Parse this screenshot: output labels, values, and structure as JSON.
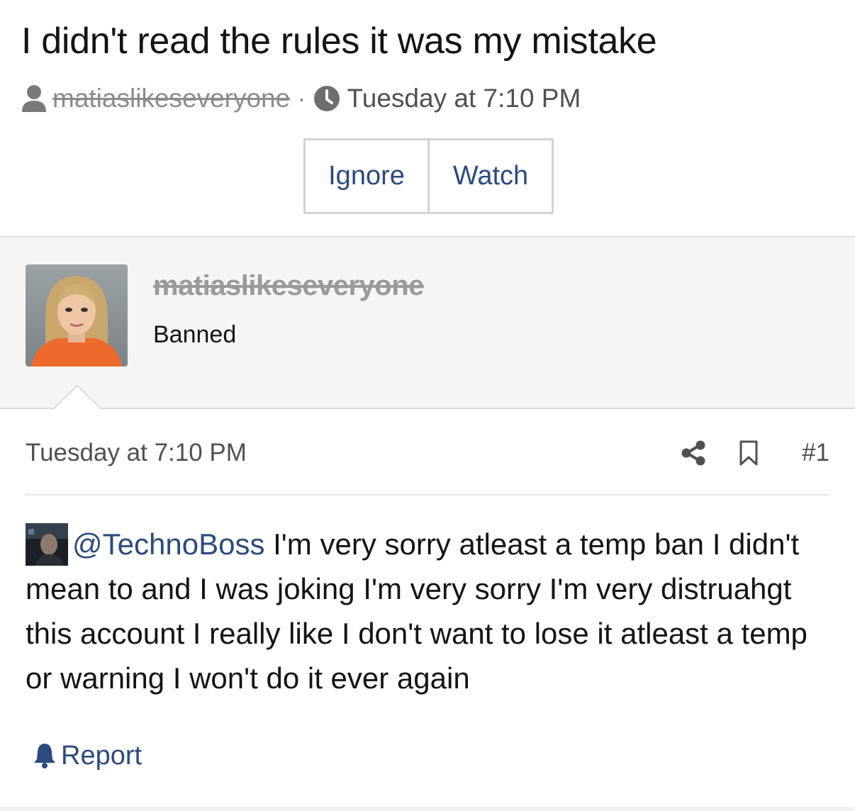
{
  "thread": {
    "title": "I didn't read the rules it was my mistake",
    "author": "matiaslikeseveryone",
    "separator": "·",
    "time": "Tuesday at 7:10 PM"
  },
  "actions": {
    "ignore_label": "Ignore",
    "watch_label": "Watch"
  },
  "user": {
    "name": "matiaslikeseveryone",
    "title": "Banned"
  },
  "post": {
    "time": "Tuesday at 7:10 PM",
    "number": "#1",
    "mention": "@TechnoBoss",
    "body": " I'm very sorry atleast a temp ban I didn't mean to and I was joking I'm very sorry I'm very distruahgt this account I really like I don't want to lose it atleast a temp or warning I won't do it ever again"
  },
  "footer": {
    "report_label": "Report"
  },
  "colors": {
    "link": "#2c4a7f",
    "muted": "#8c8c8c",
    "user_block_bg": "#f5f5f5"
  },
  "icons": {
    "author": "user-icon",
    "time": "clock-icon",
    "share": "share-icon",
    "bookmark": "bookmark-icon",
    "report": "bell-icon"
  }
}
